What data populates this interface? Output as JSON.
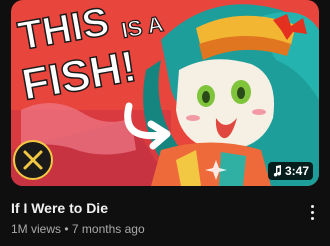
{
  "video": {
    "title": "If I Were to Die",
    "views": "1M views",
    "separator": "•",
    "age": "7 months ago",
    "duration": "3:47",
    "thumbnail_text": {
      "line1_a": "THIS",
      "line1_b": "IS A",
      "line2": "FISH!"
    }
  },
  "icons": {
    "duration_prefix": "music-note-icon",
    "menu": "more-vert-icon",
    "channel_logo": "theory-logo-icon"
  },
  "colors": {
    "background": "#0f0f0f",
    "title": "#f1f1f1",
    "secondary_text": "#aaaaaa",
    "thumb_bg": "#e8453c",
    "thumb_accent_teal": "#1d9e9a",
    "thumb_text": "#ffffff"
  }
}
